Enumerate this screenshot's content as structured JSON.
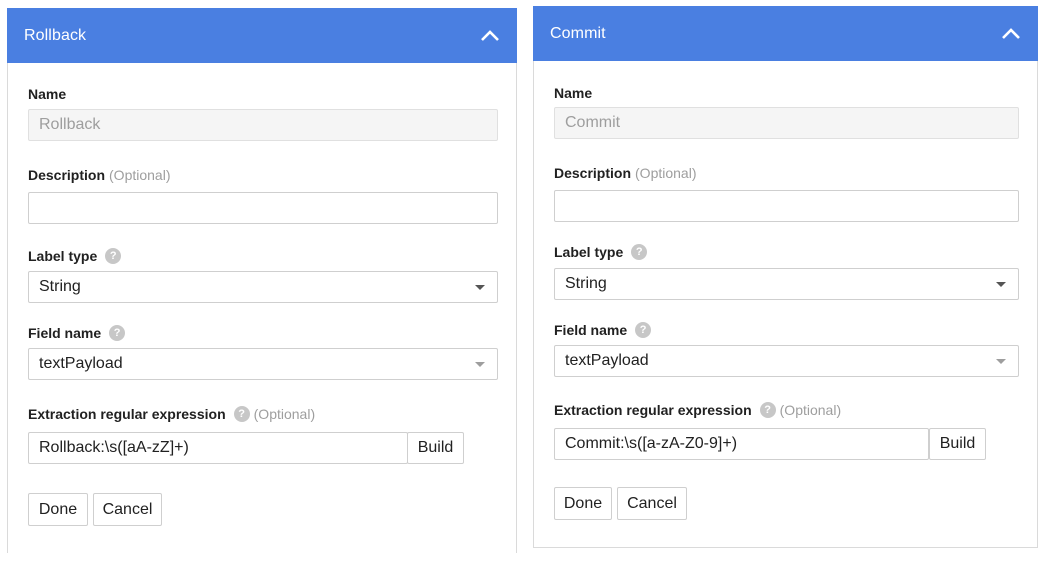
{
  "panels": [
    {
      "title": "Rollback",
      "name_label": "Name",
      "name_value": "Rollback",
      "description_label": "Description",
      "description_optional": "(Optional)",
      "description_value": "",
      "label_type_label": "Label type",
      "label_type_value": "String",
      "field_name_label": "Field name",
      "field_name_value": "textPayload",
      "regex_label": "Extraction regular expression",
      "regex_optional": "(Optional)",
      "regex_value": "Rollback:\\s([aA-zZ]+)",
      "build_label": "Build",
      "done_label": "Done",
      "cancel_label": "Cancel"
    },
    {
      "title": "Commit",
      "name_label": "Name",
      "name_value": "Commit",
      "description_label": "Description",
      "description_optional": "(Optional)",
      "description_value": "",
      "label_type_label": "Label type",
      "label_type_value": "String",
      "field_name_label": "Field name",
      "field_name_value": "textPayload",
      "regex_label": "Extraction regular expression",
      "regex_optional": "(Optional)",
      "regex_value": "Commit:\\s([a-zA-Z0-9]+)",
      "build_label": "Build",
      "done_label": "Done",
      "cancel_label": "Cancel"
    }
  ],
  "icons": {
    "collapse": "chevron-up-icon",
    "help": "help-icon",
    "dropdown": "caret-down-icon",
    "help_glyph": "?"
  },
  "colors": {
    "header": "#4a7fe1",
    "help_icon": "#c7c7c7",
    "border": "#cfcfcf"
  }
}
